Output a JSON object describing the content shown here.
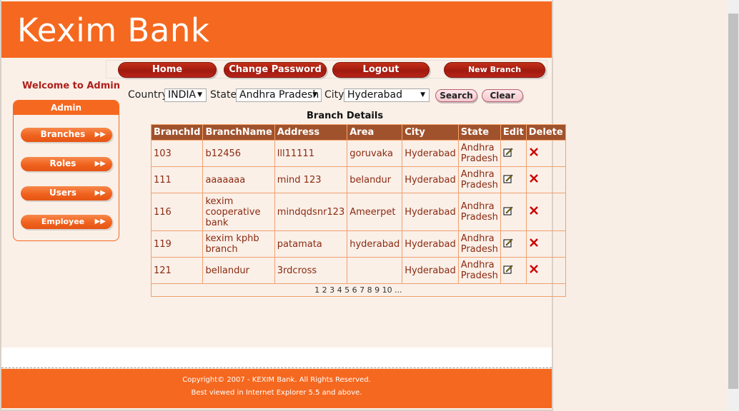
{
  "app": {
    "logo_text": "Kexim Bank"
  },
  "nav": {
    "home": "Home",
    "change_password": "Change Password",
    "logout": "Logout",
    "new_branch": "New Branch"
  },
  "sidebar": {
    "welcome": "Welcome to Admin",
    "title": "Admin",
    "items": [
      {
        "label": "Branches"
      },
      {
        "label": "Roles"
      },
      {
        "label": "Users"
      },
      {
        "label": "Employee"
      }
    ]
  },
  "filters": {
    "country_label": "Country",
    "country_value": "INDIA",
    "state_label": "State",
    "state_value": "Andhra Pradesh",
    "city_label": "City",
    "city_value": "Hyderabad",
    "search_label": "Search",
    "clear_label": "Clear"
  },
  "table": {
    "caption": "Branch Details",
    "headers": [
      "BranchId",
      "BranchName",
      "Address",
      "Area",
      "City",
      "State",
      "Edit",
      "Delete"
    ],
    "rows": [
      [
        "103",
        "b12456",
        "lll11111",
        "goruvaka",
        "Hyderabad",
        "Andhra Pradesh"
      ],
      [
        "111",
        "aaaaaaa",
        "mind 123",
        "belandur",
        "Hyderabad",
        "Andhra Pradesh"
      ],
      [
        "116",
        "kexim cooperative bank",
        "mindqdsnr123",
        "Ameerpet",
        "Hyderabad",
        "Andhra Pradesh"
      ],
      [
        "119",
        "kexim kphb branch",
        "patamata",
        "hyderabad",
        "Hyderabad",
        "Andhra Pradesh"
      ],
      [
        "121",
        "bellandur",
        "3rdcross",
        "",
        "Hyderabad",
        "Andhra Pradesh"
      ]
    ],
    "pager": "1 2 3 4 5 6 7 8 9 10 ..."
  },
  "footer": {
    "line1": "Copyright© 2007 - KEXIM Bank. All Rights Reserved.",
    "line2": "Best viewed in Internet Explorer 5.5 and above."
  },
  "icons": {
    "edit": "edit-pencil-icon",
    "delete": "delete-x-icon",
    "arrow": "double-arrow-right-icon"
  },
  "colors": {
    "brand": "#f5681f",
    "header_row": "#a0522d",
    "nav_button": "#b3200f",
    "text_accent": "#b0201b"
  }
}
